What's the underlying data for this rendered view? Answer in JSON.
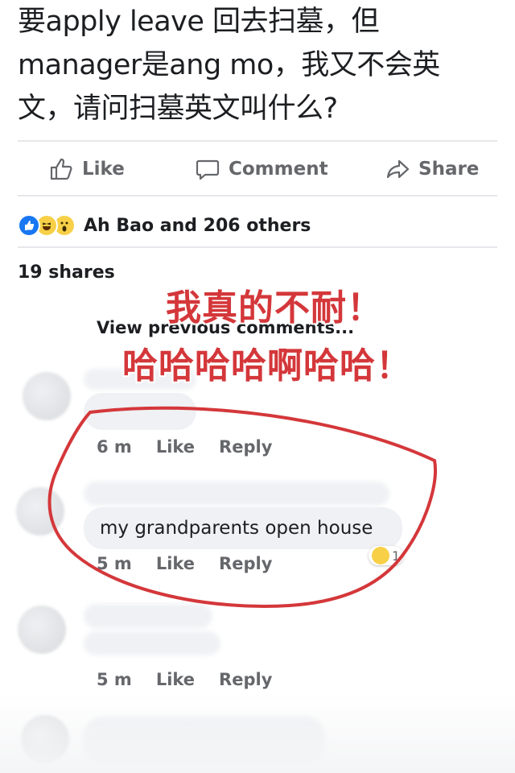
{
  "post": {
    "line1": "要apply leave 回去扫墓，但",
    "line2": "manager是ang mo，我又不会英",
    "line3": "文，请问扫墓英文叫什么?"
  },
  "actions": {
    "like_label": "Like",
    "comment_label": "Comment",
    "share_label": "Share",
    "like_icon": "thumbs-up-icon",
    "comment_icon": "speech-bubble-icon",
    "share_icon": "share-arrow-icon"
  },
  "reactions": {
    "icons": [
      "like-reaction-icon",
      "haha-reaction-icon",
      "wow-reaction-icon"
    ],
    "text": "Ah Bao and 206 others"
  },
  "shares": "19 shares",
  "view_previous": "View previous comments...",
  "overlay": {
    "line1": "我真的不耐！",
    "line2": "哈哈哈哈啊哈哈！",
    "color": "#d4373a"
  },
  "comments": [
    {
      "text": "",
      "time": "6 m",
      "like": "Like",
      "reply": "Reply"
    },
    {
      "text": "my grandparents open house",
      "time": "5 m",
      "like": "Like",
      "reply": "Reply",
      "reaction_icon": "haha-reaction-icon",
      "reaction_count": "1"
    },
    {
      "text": "",
      "time": "5 m",
      "like": "Like",
      "reply": "Reply"
    }
  ],
  "colors": {
    "text": "#1c1e21",
    "muted": "#65676b",
    "accent_blue": "#1877f2",
    "bubble": "#eff1f4",
    "annotation_red": "#d4373a"
  }
}
